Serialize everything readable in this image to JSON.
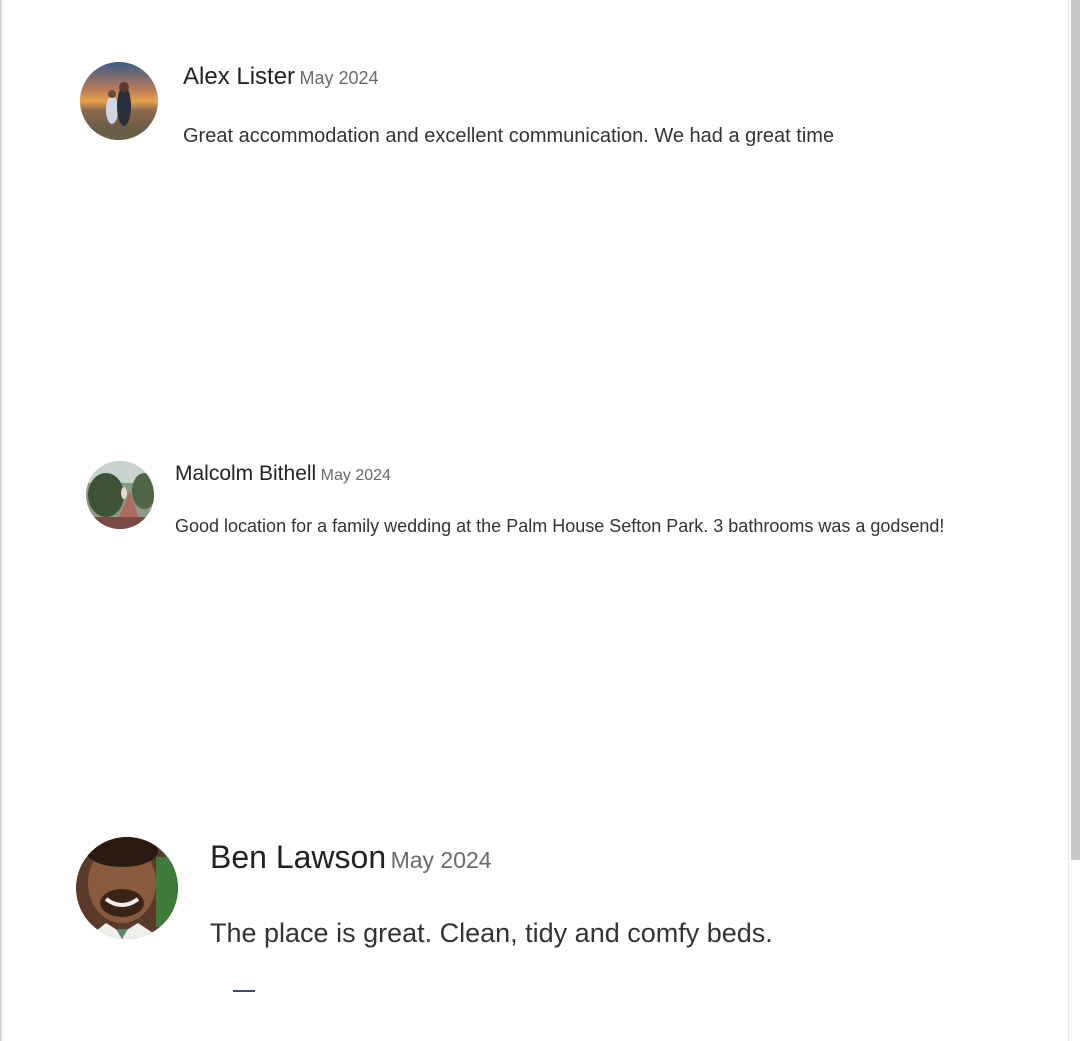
{
  "reviews": [
    {
      "name": "Alex Lister",
      "date": "May 2024",
      "text": "Great accommodation and excellent communication. We had a great time",
      "avatar_icon": "user-avatar-photo"
    },
    {
      "name": "Malcolm Bithell",
      "date": "May 2024",
      "text": "Good location for a family wedding at the Palm House Sefton Park. 3 bathrooms was a godsend!",
      "avatar_icon": "user-avatar-photo"
    },
    {
      "name": "Ben Lawson",
      "date": "May 2024",
      "text": "The place is great. Clean, tidy and comfy beds.",
      "avatar_icon": "user-avatar-photo"
    }
  ],
  "colors": {
    "text_primary": "#222222",
    "text_secondary": "#6a6a6a",
    "background": "#ffffff"
  }
}
